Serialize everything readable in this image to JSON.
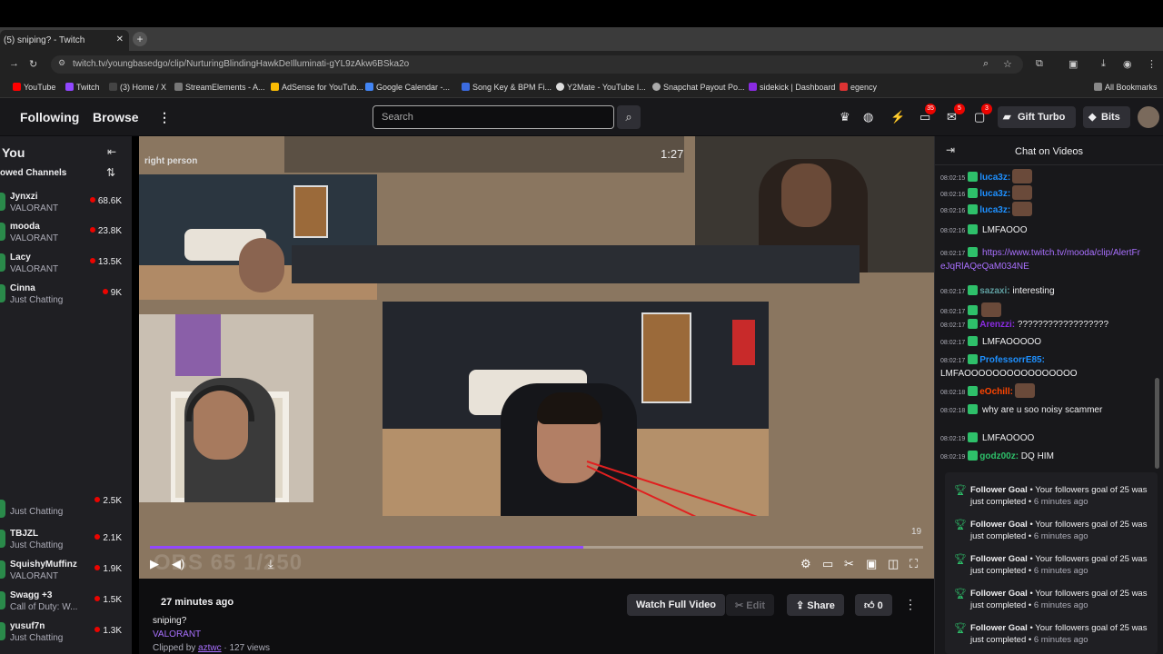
{
  "browser": {
    "tab_title": "(5) sniping? - Twitch",
    "url": "twitch.tv/youngbasedgo/clip/NurturingBlindingHawkDeIlluminati-gYL9zAkw6BSka2o",
    "bookmarks": [
      "YouTube",
      "Twitch",
      "(3) Home / X",
      "StreamElements - A...",
      "AdSense for YouTub...",
      "Google Calendar -...",
      "Song Key & BPM Fi...",
      "Y2Mate - YouTube I...",
      "Snapchat Payout Po...",
      "sidekick | Dashboard",
      "egency"
    ],
    "all_bookmarks": "All Bookmarks"
  },
  "colors": {
    "twitch_purple": "#9147ff",
    "live_red": "#eb0400",
    "online_green": "#2a8a4a"
  },
  "twitch_nav": {
    "following": "Following",
    "browse": "Browse",
    "search_placeholder": "Search",
    "badges": [
      "35",
      "5",
      "3"
    ],
    "gift_turbo": "Gift Turbo",
    "bits": "Bits"
  },
  "sidebar": {
    "header": "You",
    "section": "owed Channels",
    "channels": [
      {
        "name": "Jynxzi",
        "game": "VALORANT",
        "viewers": "68.6K"
      },
      {
        "name": "mooda",
        "game": "VALORANT",
        "viewers": "23.8K"
      },
      {
        "name": "Lacy",
        "game": "VALORANT",
        "viewers": "13.5K"
      },
      {
        "name": "Cinna",
        "game": "Just Chatting",
        "viewers": "9K"
      }
    ],
    "channels_lower": [
      {
        "name": "Just Chatting",
        "game": "",
        "viewers": "2.5K"
      },
      {
        "name": "TBJZL",
        "game": "Just Chatting",
        "viewers": "2.1K"
      },
      {
        "name": "SquishyMuffinz",
        "game": "VALORANT",
        "viewers": "1.9K"
      },
      {
        "name": "Swagg +3",
        "game": "Call of Duty: W...",
        "viewers": "1.5K"
      },
      {
        "name": "yusuf7n",
        "game": "Just Chatting",
        "viewers": "1.3K"
      }
    ]
  },
  "video": {
    "overlay_text": "right person",
    "game_timer": "1:27",
    "ghost_text": "OBS 65 1/250",
    "frame_counter": "19",
    "progress": 0.56
  },
  "clip_info": {
    "ago": "27 minutes ago",
    "title": "sniping?",
    "game": "VALORANT",
    "clipped_by_prefix": "Clipped by",
    "clipper": "aztwc",
    "views": "· 127 views",
    "watch_full": "Watch Full Video",
    "edit": "Edit",
    "share": "Share",
    "likes": "0"
  },
  "chat": {
    "title": "Chat on Videos",
    "messages": [
      {
        "time": "08:02:15",
        "user": "luca3z:",
        "text": "",
        "color": "#1e90ff"
      },
      {
        "time": "08:02:16",
        "user": "luca3z:",
        "text": "",
        "color": "#1e90ff"
      },
      {
        "time": "08:02:16",
        "user": "luca3z:",
        "text": "",
        "color": "#1e90ff"
      },
      {
        "time": "08:02:16",
        "user": "",
        "text": "LMFAOOO",
        "color": "#8a2be2"
      },
      {
        "time": "08:02:17",
        "user": "",
        "text": "https://www.twitch.tv/mooda/clip/AlertFr eJqRlAQeQaM034NE",
        "color": "#8a2be2"
      },
      {
        "time": "08:02:17",
        "user": "sazaxi:",
        "text": "interesting",
        "color": "#5f9ea0"
      },
      {
        "time": "08:02:17",
        "user": "",
        "text": "",
        "color": "#daa520"
      },
      {
        "time": "08:02:17",
        "user": "Arenzzi:",
        "text": "??????????????????",
        "color": "#8a2be2"
      },
      {
        "time": "08:02:17",
        "user": "",
        "text": "LMFAOOOOO",
        "color": "#8a2be2"
      },
      {
        "time": "08:02:17",
        "user": "ProfessorrE85:",
        "text": "LMFAOOOOOOOOOOOOOOOO",
        "color": "#1e90ff"
      },
      {
        "time": "08:02:18",
        "user": "eOchill:",
        "text": "",
        "color": "#ff4500"
      },
      {
        "time": "08:02:18",
        "user": "",
        "text": "why are u soo noisy scammer",
        "color": "#8a2be2"
      },
      {
        "time": "08:02:19",
        "user": "",
        "text": "LMFAOOOO",
        "color": "#ff0000"
      },
      {
        "time": "08:02:19",
        "user": "godz00z:",
        "text": "DQ HIM",
        "color": "#2ec06a"
      }
    ]
  },
  "notifications": [
    {
      "title": "Follower Goal",
      "text": "Your followers goal of 25 was just completed",
      "ago": "6 minutes ago"
    },
    {
      "title": "Follower Goal",
      "text": "Your followers goal of 25 was just completed",
      "ago": "6 minutes ago"
    },
    {
      "title": "Follower Goal",
      "text": "Your followers goal of 25 was just completed",
      "ago": "6 minutes ago"
    },
    {
      "title": "Follower Goal",
      "text": "Your followers goal of 25 was just completed",
      "ago": "6 minutes ago"
    },
    {
      "title": "Follower Goal",
      "text": "Your followers goal of 25 was just completed",
      "ago": "6 minutes ago"
    }
  ]
}
